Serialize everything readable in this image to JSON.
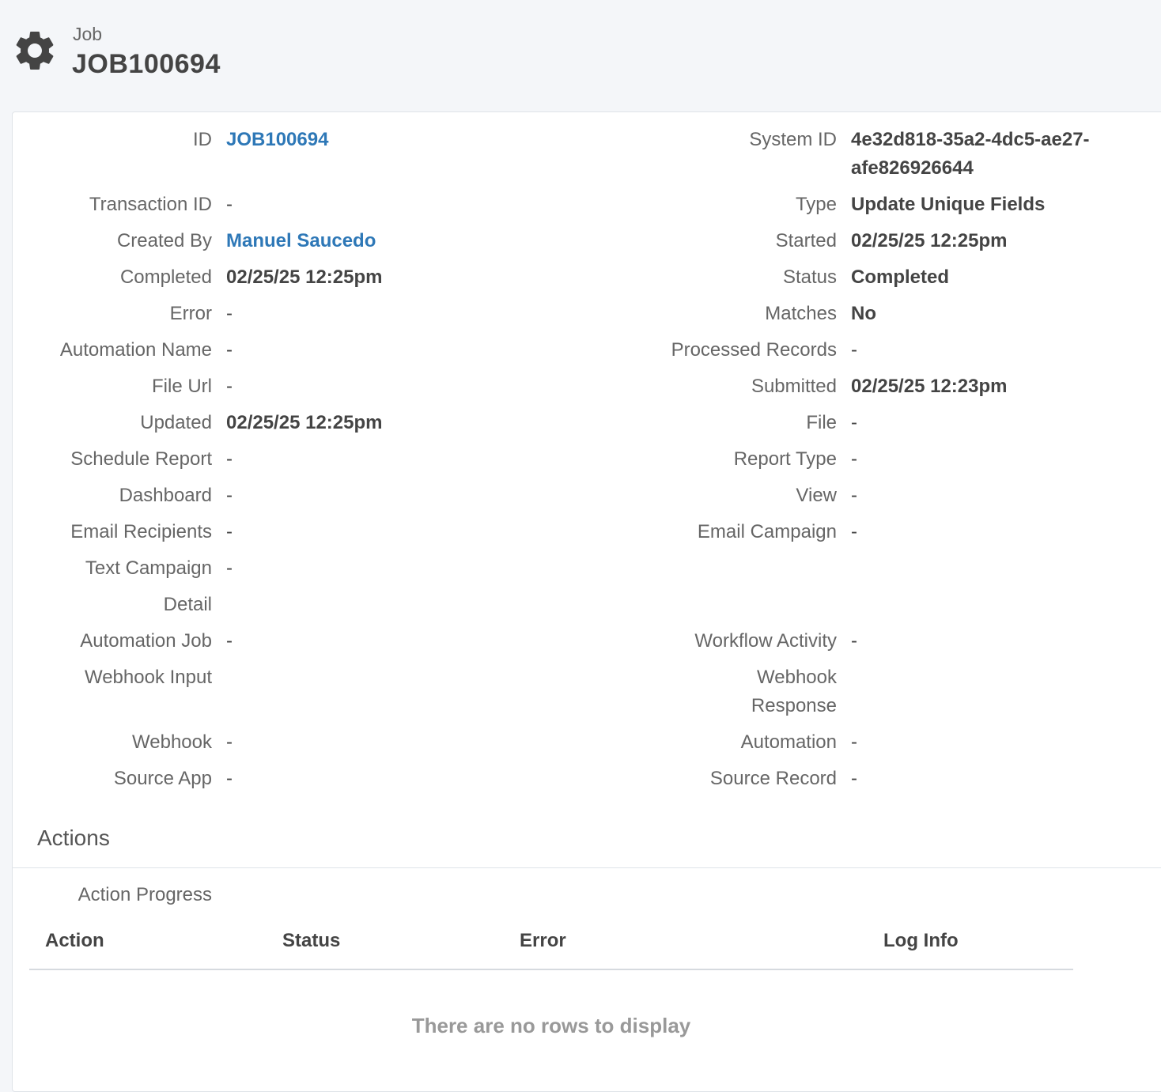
{
  "header": {
    "subtitle": "Job",
    "title": "JOB100694"
  },
  "fields": {
    "id": {
      "label": "ID",
      "value": "JOB100694"
    },
    "system_id": {
      "label": "System ID",
      "value_line1": "4e32d818-35a2-4dc5-ae27-",
      "value_line2": "afe826926644"
    },
    "transaction_id": {
      "label": "Transaction ID",
      "value": "-"
    },
    "type": {
      "label": "Type",
      "value": "Update Unique Fields"
    },
    "created_by": {
      "label": "Created By",
      "value": "Manuel Saucedo"
    },
    "started": {
      "label": "Started",
      "value": "02/25/25 12:25pm"
    },
    "completed": {
      "label": "Completed",
      "value": "02/25/25 12:25pm"
    },
    "status": {
      "label": "Status",
      "value": "Completed"
    },
    "error": {
      "label": "Error",
      "value": "-"
    },
    "matches": {
      "label": "Matches",
      "value": "No"
    },
    "automation_name": {
      "label": "Automation Name",
      "value": "-"
    },
    "processed_records": {
      "label": "Processed Records",
      "value": "-"
    },
    "file_url": {
      "label": "File Url",
      "value": "-"
    },
    "submitted": {
      "label": "Submitted",
      "value": "02/25/25 12:23pm"
    },
    "updated": {
      "label": "Updated",
      "value": "02/25/25 12:25pm"
    },
    "file": {
      "label": "File",
      "value": "-"
    },
    "schedule_report": {
      "label": "Schedule Report",
      "value": "-"
    },
    "report_type": {
      "label": "Report Type",
      "value": "-"
    },
    "dashboard": {
      "label": "Dashboard",
      "value": "-"
    },
    "view": {
      "label": "View",
      "value": "-"
    },
    "email_recipients": {
      "label": "Email Recipients",
      "value": "-"
    },
    "email_campaign": {
      "label": "Email Campaign",
      "value": "-"
    },
    "text_campaign": {
      "label": "Text Campaign",
      "value": "-"
    },
    "detail": {
      "label": "Detail"
    },
    "automation_job": {
      "label": "Automation Job",
      "value": "-"
    },
    "workflow_activity": {
      "label": "Workflow Activity",
      "value": "-"
    },
    "webhook_input": {
      "label": "Webhook Input"
    },
    "webhook_response": {
      "label_line1": "Webhook",
      "label_line2": "Response"
    },
    "webhook": {
      "label": "Webhook",
      "value": "-"
    },
    "automation": {
      "label": "Automation",
      "value": "-"
    },
    "source_app": {
      "label": "Source App",
      "value": "-"
    },
    "source_record": {
      "label": "Source Record",
      "value": "-"
    }
  },
  "actions": {
    "section_title": "Actions",
    "progress_label": "Action Progress",
    "columns": [
      "Action",
      "Status",
      "Error",
      "Log Info"
    ],
    "empty_message": "There are no rows to display"
  }
}
